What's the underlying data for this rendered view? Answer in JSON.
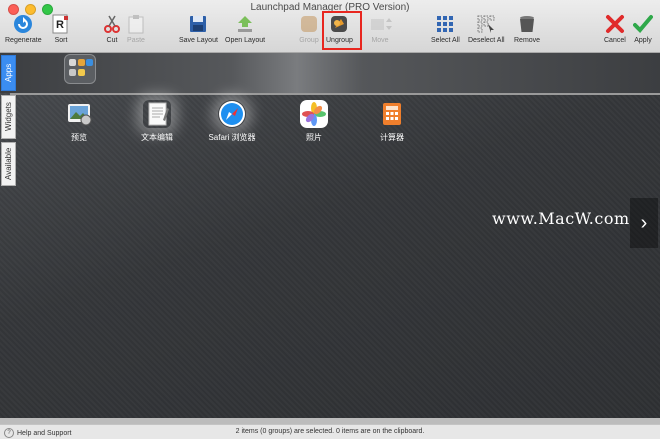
{
  "window": {
    "title": "Launchpad Manager (PRO Version)"
  },
  "toolbar": {
    "regenerate": "Regenerate",
    "sort": "Sort",
    "cut": "Cut",
    "paste": "Paste",
    "save_layout": "Save Layout",
    "open_layout": "Open Layout",
    "group": "Group",
    "ungroup": "Ungroup",
    "move": "Move",
    "select_all": "Select All",
    "deselect_all": "Deselect All",
    "remove": "Remove",
    "cancel": "Cancel",
    "apply": "Apply"
  },
  "sidebar": {
    "tabs": [
      "Apps",
      "Widgets",
      "Available"
    ],
    "active": "Apps"
  },
  "apps": [
    {
      "label": "预览",
      "icon": "preview-icon"
    },
    {
      "label": "文本编辑",
      "icon": "textedit-icon"
    },
    {
      "label": "Safari 浏览器",
      "icon": "safari-icon"
    },
    {
      "label": "照片",
      "icon": "photos-icon"
    },
    {
      "label": "计算器",
      "icon": "calculator-icon"
    }
  ],
  "watermark": "www.MacW.com",
  "status": {
    "help": "Help and Support",
    "message": "2 items (0 groups) are selected. 0 items are on the clipboard."
  },
  "colors": {
    "accent": "#3b8df1",
    "highlight": "#e8261f"
  }
}
